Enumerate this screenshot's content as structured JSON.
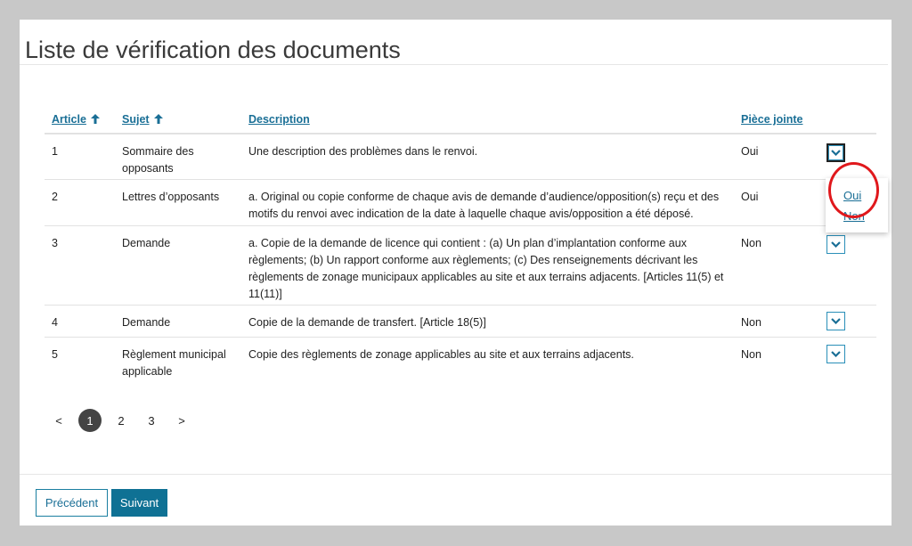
{
  "page": {
    "title": "Liste de vérification des documents"
  },
  "table": {
    "headers": {
      "article": "Article",
      "sujet": "Sujet",
      "description": "Description",
      "piece_jointe": "Pièce jointe"
    },
    "rows": [
      {
        "article": "1",
        "sujet": "Sommaire des opposants",
        "description": "Une description des problèmes dans le renvoi.",
        "piece_jointe": "Oui"
      },
      {
        "article": "2",
        "sujet": "Lettres d’opposants",
        "description": "a. Original ou copie conforme de chaque avis de demande d’audience/opposition(s) reçu et des motifs du renvoi avec indication de la date à laquelle chaque avis/opposition a été déposé.",
        "piece_jointe": "Oui"
      },
      {
        "article": "3",
        "sujet": "Demande",
        "description": "a. Copie de la demande de licence qui contient : (a) Un plan d’implantation conforme aux règlements; (b) Un rapport conforme aux règlements; (c) Des renseignements décrivant les règlements de zonage municipaux applicables au site et aux terrains adjacents. [Articles 11(5) et 11(11)]",
        "piece_jointe": "Non"
      },
      {
        "article": "4",
        "sujet": "Demande",
        "description": "Copie de la demande de transfert. [Article 18(5)]",
        "piece_jointe": "Non"
      },
      {
        "article": "5",
        "sujet": "Règlement municipal applicable",
        "description": "Copie des règlements de zonage applicables au site et aux terrains adjacents.",
        "piece_jointe": "Non"
      }
    ]
  },
  "dropdown": {
    "options": [
      "Oui",
      "Non"
    ]
  },
  "pagination": {
    "prev": "<",
    "pages": [
      "1",
      "2",
      "3"
    ],
    "current": "1",
    "next": ">"
  },
  "buttons": {
    "previous": "Précédent",
    "next": "Suivant"
  },
  "colors": {
    "accent": "#1a6f96",
    "primary_button": "#0f7194",
    "highlight": "#e0181c"
  }
}
